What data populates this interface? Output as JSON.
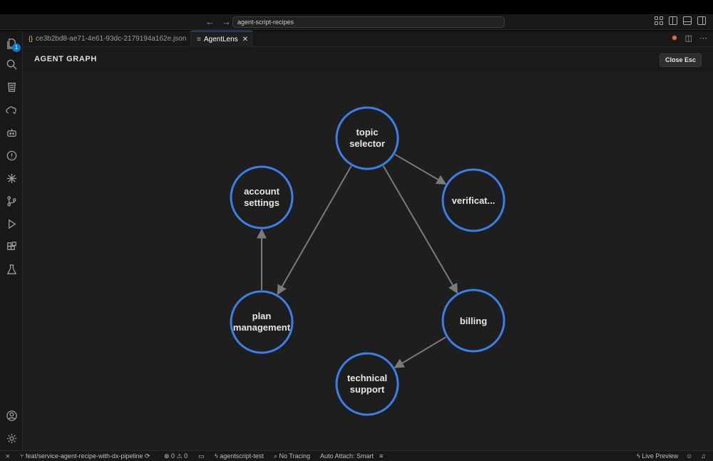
{
  "window": {
    "command_center": "agent-script-recipes",
    "nav_back": "←",
    "nav_forward": "→"
  },
  "activity_bar": {
    "explorer_badge": "1"
  },
  "tabs": [
    {
      "label": "ce3b2bd8-ae71-4e61-93dc-2179194a162e.json",
      "icon": "{}"
    },
    {
      "label": "AgentLens",
      "close": "✕"
    }
  ],
  "graph": {
    "title": "AGENT GRAPH",
    "close_button": "Close Esc",
    "node_color": "#3b7fe8",
    "edge_color": "#7a7a7a",
    "nodes": [
      {
        "id": "topic",
        "line1": "topic",
        "line2": "selector"
      },
      {
        "id": "account",
        "line1": "account",
        "line2": "settings"
      },
      {
        "id": "verif",
        "line1": "verificat...",
        "line2": ""
      },
      {
        "id": "plan",
        "line1": "plan",
        "line2": "management"
      },
      {
        "id": "billing",
        "line1": "billing",
        "line2": ""
      },
      {
        "id": "tech",
        "line1": "technical",
        "line2": "support"
      }
    ],
    "edges": [
      {
        "from": "topic",
        "to": "verif"
      },
      {
        "from": "topic",
        "to": "plan"
      },
      {
        "from": "topic",
        "to": "billing"
      },
      {
        "from": "plan",
        "to": "account"
      },
      {
        "from": "billing",
        "to": "tech"
      }
    ]
  },
  "status_bar": {
    "branch": "feat/service-agent-recipe-with-dx-pipeline",
    "errors": "0",
    "warnings": "0",
    "org": "agentscript-test",
    "tracing": "No Tracing",
    "auto_attach": "Auto Attach: Smart",
    "live_preview": "Live Preview"
  }
}
